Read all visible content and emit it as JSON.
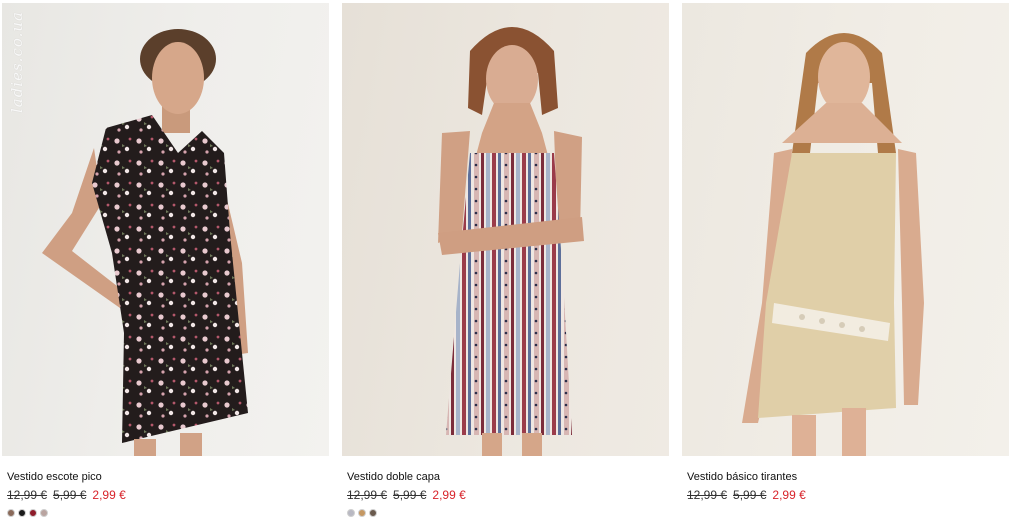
{
  "products": [
    {
      "name": "Vestido escote pico",
      "old_price_1": "12,99 €",
      "old_price_2": "5,99 €",
      "price": "2,99 €",
      "swatches": [
        "#8a6a5a",
        "#1a1a1a",
        "#8e1c2a",
        "#b9a4a0"
      ],
      "watermark": "ladies.co.ua"
    },
    {
      "name": "Vestido doble capa",
      "old_price_1": "12,99 €",
      "old_price_2": "5,99 €",
      "price": "2,99 €",
      "swatches": [
        "#b9b9c3",
        "#c59863",
        "#6a5a4d"
      ]
    },
    {
      "name": "Vestido básico tirantes",
      "old_price_1": "12,99 €",
      "old_price_2": "5,99 €",
      "price": "2,99 €"
    }
  ],
  "colors": {
    "sale_red": "#d8232a",
    "text": "#111111"
  }
}
